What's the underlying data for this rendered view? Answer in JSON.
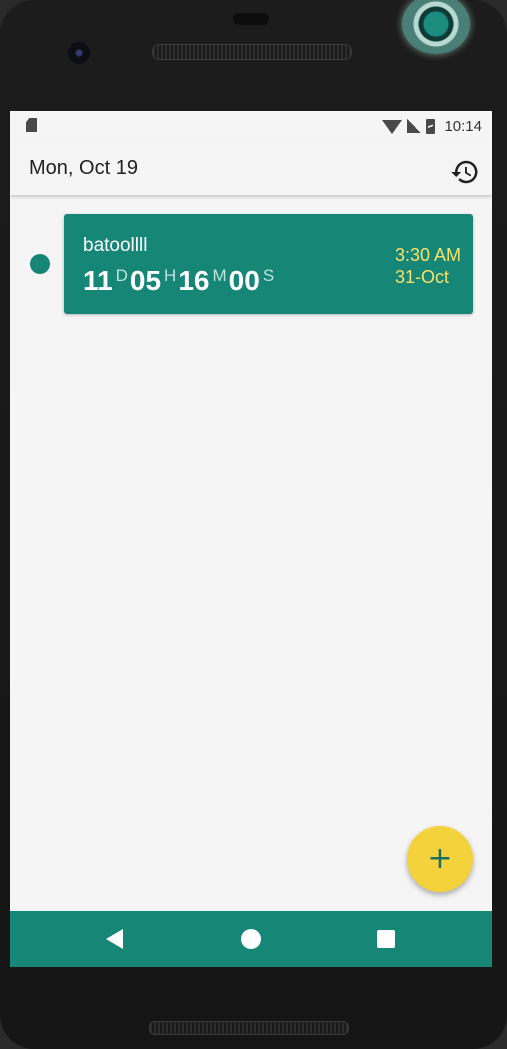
{
  "status_bar": {
    "time": "10:14",
    "icons": [
      "sd-card-icon",
      "wifi-icon",
      "signal-icon",
      "battery-charging-icon"
    ]
  },
  "app_bar": {
    "title": "Mon, Oct 19",
    "action_icon": "history-icon"
  },
  "events": [
    {
      "name": "batoollll",
      "countdown": {
        "days": "11",
        "days_unit": "D",
        "hours": "05",
        "hours_unit": "H",
        "minutes": "16",
        "minutes_unit": "M",
        "seconds": "00",
        "seconds_unit": "S"
      },
      "time": "3:30 AM",
      "date": "31-Oct"
    }
  ],
  "fab": {
    "icon": "plus-icon",
    "label": "+"
  },
  "nav_bar": {
    "icons": [
      "back-icon",
      "home-icon",
      "recents-icon"
    ]
  },
  "colors": {
    "primary": "#168677",
    "accent": "#f4d23c",
    "event_time": "#f7e26a",
    "background": "#f5f5f5"
  }
}
